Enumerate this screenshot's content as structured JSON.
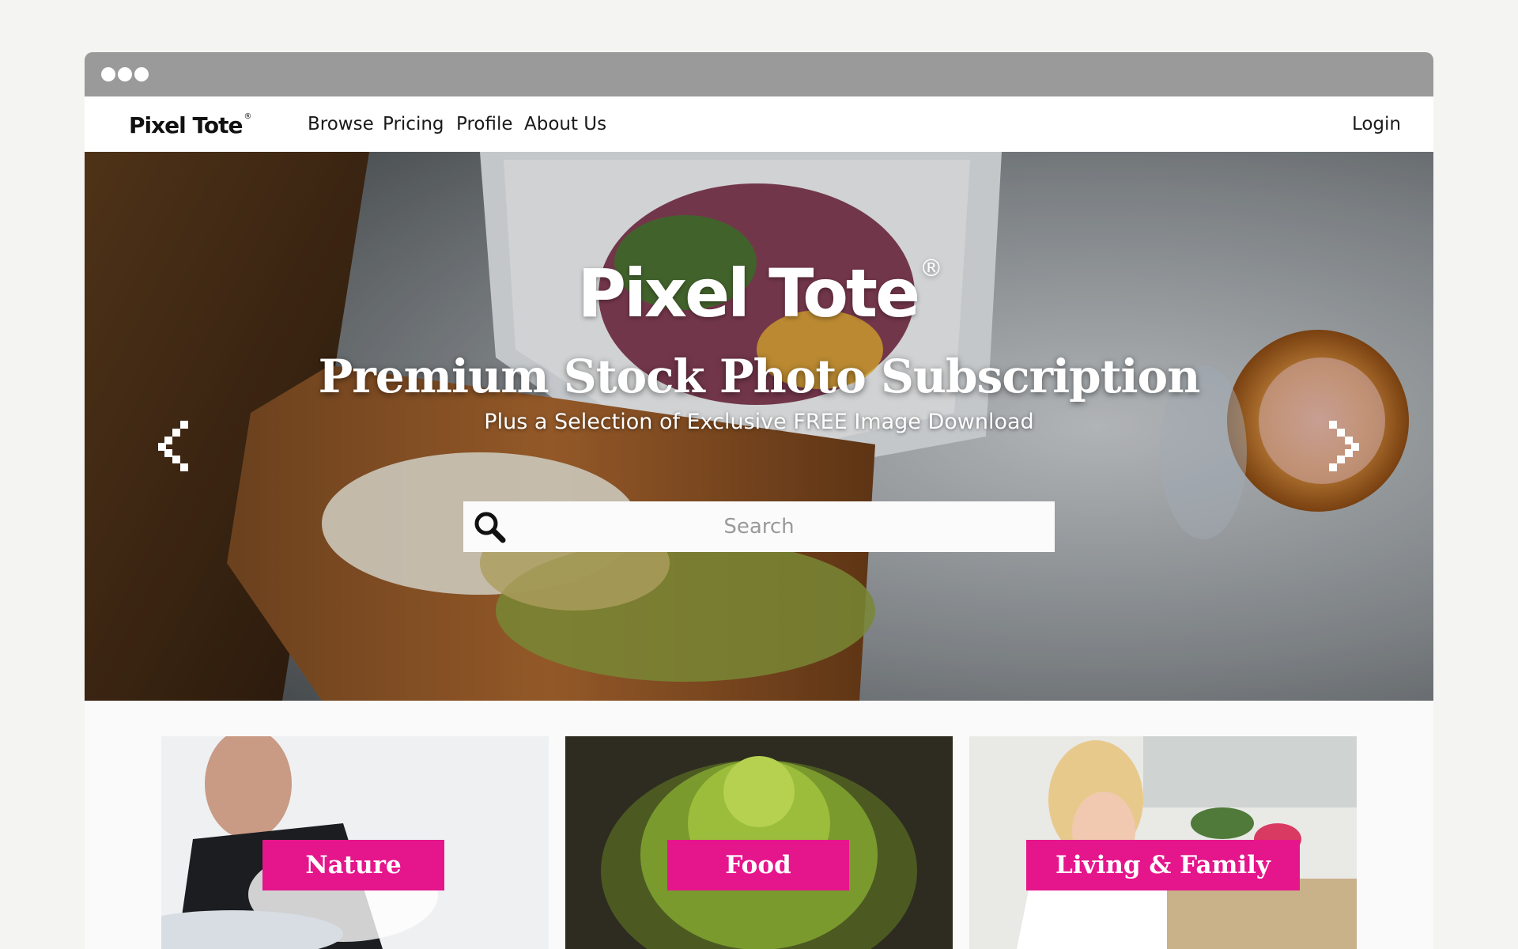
{
  "window": {
    "dots": [
      "close",
      "minimize",
      "maximize"
    ]
  },
  "nav": {
    "logo": "Pixel Tote",
    "logo_mark": "®",
    "links": [
      "Browse",
      "Pricing",
      "Profile",
      "About Us"
    ],
    "login": "Login"
  },
  "hero": {
    "logo": "Pixel Tote",
    "logo_mark": "®",
    "title": "Premium Stock Photo Subscription",
    "subtitle": "Plus a Selection of Exclusive FREE Image Download",
    "search": {
      "placeholder": "Search",
      "value": ""
    },
    "icons": {
      "prev": "chevron-left-icon",
      "next": "chevron-right-icon",
      "search": "search-icon"
    }
  },
  "categories": [
    {
      "label": "Nature"
    },
    {
      "label": "Food"
    },
    {
      "label": "Living & Family"
    }
  ],
  "colors": {
    "accent": "#e5158c",
    "titlebar": "#9a9a9a",
    "nav_bg": "#ffffff"
  }
}
